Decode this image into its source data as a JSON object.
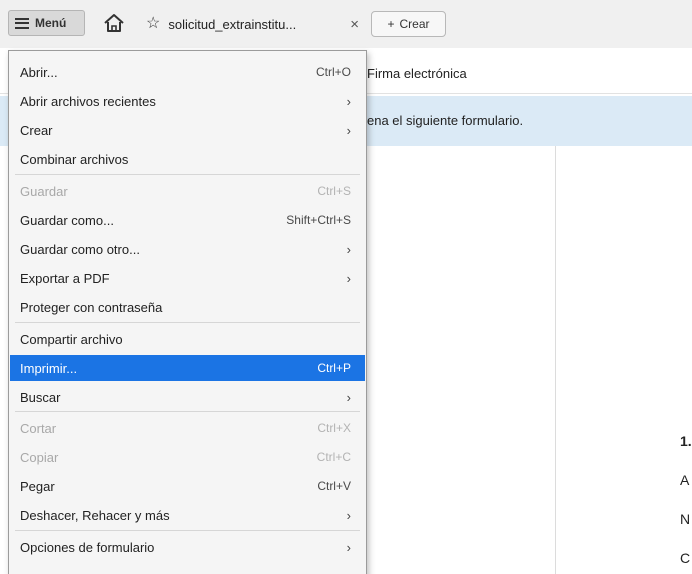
{
  "topbar": {
    "menu_label": "Menú",
    "tab_title": "solicitud_extrainstitu...",
    "tab_close": "×",
    "crear_plus": "+",
    "crear_label": "Crear"
  },
  "document": {
    "title": "Firma electrónica",
    "banner": "ena el siguiente formulario.",
    "fragments": [
      "1.",
      "A",
      "N",
      "C"
    ]
  },
  "menu": {
    "items": [
      {
        "label": "Abrir...",
        "shortcut": "Ctrl+O",
        "submenu": false,
        "disabled": false
      },
      {
        "label": "Abrir archivos recientes",
        "shortcut": "",
        "submenu": true,
        "disabled": false
      },
      {
        "label": "Crear",
        "shortcut": "",
        "submenu": true,
        "disabled": false
      },
      {
        "label": "Combinar archivos",
        "shortcut": "",
        "submenu": false,
        "disabled": false
      },
      {
        "label": "Guardar",
        "shortcut": "Ctrl+S",
        "submenu": false,
        "disabled": true
      },
      {
        "label": "Guardar como...",
        "shortcut": "Shift+Ctrl+S",
        "submenu": false,
        "disabled": false
      },
      {
        "label": "Guardar como otro...",
        "shortcut": "",
        "submenu": true,
        "disabled": false
      },
      {
        "label": "Exportar a PDF",
        "shortcut": "",
        "submenu": true,
        "disabled": false
      },
      {
        "label": "Proteger con contraseña",
        "shortcut": "",
        "submenu": false,
        "disabled": false
      },
      {
        "label": "Compartir archivo",
        "shortcut": "",
        "submenu": false,
        "disabled": false
      },
      {
        "label": "Imprimir...",
        "shortcut": "Ctrl+P",
        "submenu": false,
        "disabled": false,
        "highlighted": true
      },
      {
        "label": "Buscar",
        "shortcut": "",
        "submenu": true,
        "disabled": false
      },
      {
        "label": "Cortar",
        "shortcut": "Ctrl+X",
        "submenu": false,
        "disabled": true
      },
      {
        "label": "Copiar",
        "shortcut": "Ctrl+C",
        "submenu": false,
        "disabled": true
      },
      {
        "label": "Pegar",
        "shortcut": "Ctrl+V",
        "submenu": false,
        "disabled": false
      },
      {
        "label": "Deshacer, Rehacer y más",
        "shortcut": "",
        "submenu": true,
        "disabled": false
      },
      {
        "label": "Opciones de formulario",
        "shortcut": "",
        "submenu": true,
        "disabled": false
      }
    ],
    "submenu_glyph": "›"
  },
  "icons": {
    "menu": "hamburger-icon",
    "home": "home-icon",
    "tab": "star-icon",
    "close": "close-icon",
    "submenu": "chevron-right-icon"
  },
  "colors": {
    "highlight": "#1b74e4",
    "banner": "#dbeaf6",
    "disabled_text": "#a8a8a8"
  }
}
